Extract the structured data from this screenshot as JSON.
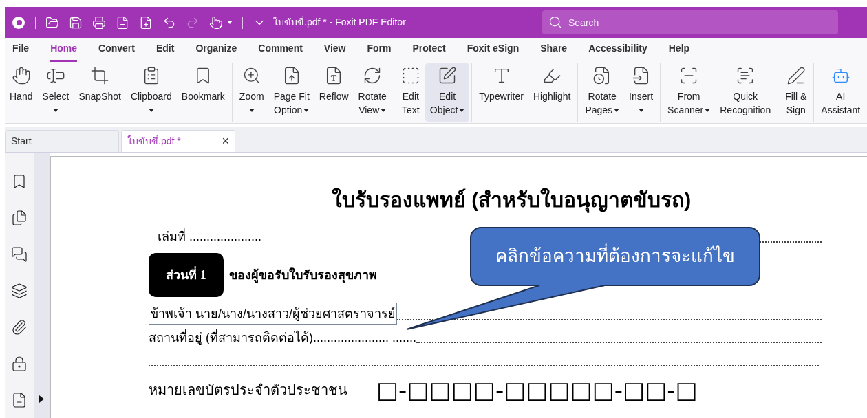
{
  "window": {
    "title": "ใบขับขี่.pdf * - Foxit PDF Editor"
  },
  "search": {
    "placeholder": "Search"
  },
  "menu_tabs": [
    {
      "label": "File",
      "selected": false
    },
    {
      "label": "Home",
      "selected": true
    },
    {
      "label": "Convert",
      "selected": false
    },
    {
      "label": "Edit",
      "selected": false
    },
    {
      "label": "Organize",
      "selected": false
    },
    {
      "label": "Comment",
      "selected": false
    },
    {
      "label": "View",
      "selected": false
    },
    {
      "label": "Form",
      "selected": false
    },
    {
      "label": "Protect",
      "selected": false
    },
    {
      "label": "Foxit eSign",
      "selected": false
    },
    {
      "label": "Share",
      "selected": false
    },
    {
      "label": "Accessibility",
      "selected": false
    },
    {
      "label": "Help",
      "selected": false
    }
  ],
  "ribbon_groups": [
    {
      "items": [
        {
          "lines": [
            "Hand"
          ],
          "dropdown": false,
          "selected": false
        },
        {
          "lines": [
            "Select"
          ],
          "dropdown": true,
          "caret_beside_label": false,
          "selected": false
        },
        {
          "lines": [
            "SnapShot"
          ],
          "dropdown": false,
          "selected": false
        },
        {
          "lines": [
            "Clipboard"
          ],
          "dropdown": true,
          "caret_beside_label": false,
          "selected": false
        },
        {
          "lines": [
            "Bookmark"
          ],
          "dropdown": false,
          "selected": false
        }
      ]
    },
    {
      "items": [
        {
          "lines": [
            "Zoom"
          ],
          "dropdown": true,
          "caret_beside_label": false,
          "selected": false
        },
        {
          "lines": [
            "Page Fit",
            "Option"
          ],
          "dropdown": true,
          "caret_beside_label": true,
          "selected": false
        },
        {
          "lines": [
            "Reflow"
          ],
          "dropdown": false,
          "selected": false
        },
        {
          "lines": [
            "Rotate",
            "View"
          ],
          "dropdown": true,
          "caret_beside_label": true,
          "selected": false
        }
      ]
    },
    {
      "items": [
        {
          "lines": [
            "Edit",
            "Text"
          ],
          "dropdown": false,
          "selected": false
        },
        {
          "lines": [
            "Edit",
            "Object"
          ],
          "dropdown": true,
          "caret_beside_label": true,
          "selected": true
        }
      ]
    },
    {
      "items": [
        {
          "lines": [
            "Typewriter"
          ],
          "dropdown": false,
          "selected": false
        },
        {
          "lines": [
            "Highlight"
          ],
          "dropdown": false,
          "selected": false
        }
      ]
    },
    {
      "items": [
        {
          "lines": [
            "Rotate",
            "Pages"
          ],
          "dropdown": true,
          "caret_beside_label": true,
          "selected": false
        },
        {
          "lines": [
            "Insert"
          ],
          "dropdown": true,
          "caret_beside_label": false,
          "selected": false
        }
      ]
    },
    {
      "items": [
        {
          "lines": [
            "From",
            "Scanner"
          ],
          "dropdown": true,
          "caret_beside_label": true,
          "selected": false
        },
        {
          "lines": [
            "Quick",
            "Recognition"
          ],
          "dropdown": false,
          "selected": false
        }
      ]
    },
    {
      "items": [
        {
          "lines": [
            "Fill &",
            "Sign"
          ],
          "dropdown": false,
          "selected": false
        }
      ]
    },
    {
      "items": [
        {
          "lines": [
            "AI",
            "Assistant"
          ],
          "dropdown": false,
          "selected": false
        }
      ]
    }
  ],
  "doc_tabs": [
    {
      "label": "Start",
      "selected": false
    },
    {
      "label": "ใบขับขี่.pdf *",
      "selected": true,
      "close": "×"
    }
  ],
  "document": {
    "title": "ใบรับรองแพทย์ (สำหรับใบอนุญาตขับรถ)",
    "book_no": "เล่มที่ .....................",
    "part_badge": "ส่วนที่ 1",
    "part_title": "ของผู้ขอรับใบรับรองสุขภาพ",
    "name_line": "ข้าพเจ้า นาย/นาง/นางสาว/ผู้ช่วยศาสตราจารย์",
    "address_line": "สถานที่อยู่ (ที่สามารถติดต่อได้)...................... .......",
    "id_label": "หมายเลขบัตรประจำตัวประชาชน",
    "id_boxes": "□-□□□□-□□□□□-□□-□"
  },
  "callout": {
    "text": "คลิกข้อความที่ต้องการจะแก้ไข"
  }
}
